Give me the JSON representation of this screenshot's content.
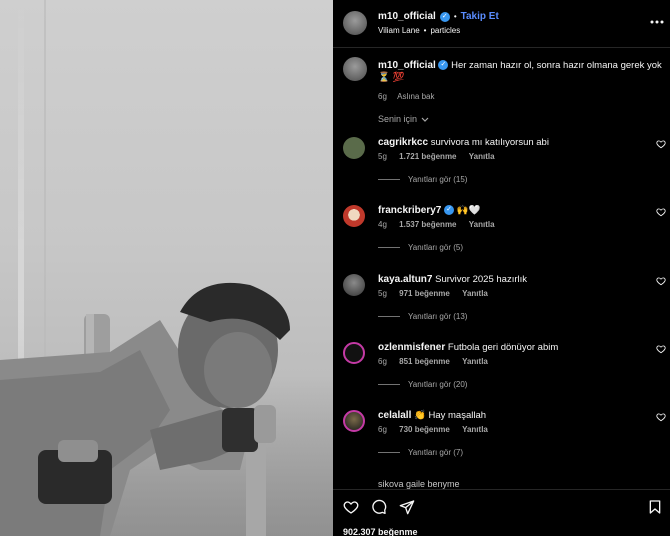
{
  "post": {
    "author": "m10_official",
    "follow_label": "Takip Et",
    "separator": "•",
    "audio": "Viliam Lane",
    "audio_sep": "•",
    "audio_track": "particles"
  },
  "caption": {
    "username": "m10_official",
    "text": "Her zaman hazır ol, sonra hazır olmana gerek yok",
    "emoji": "⏳ 💯",
    "age": "6g",
    "see_translation": "Aslına bak"
  },
  "sort": {
    "label": "Senin için"
  },
  "comments": [
    {
      "username": "cagrikrkcc",
      "verified": false,
      "text": "survivora mı katılıyorsun abi",
      "age": "5g",
      "likes": "1.721 beğenme",
      "reply": "Yanıtla",
      "replies": "Yanıtları gör (15)",
      "avatar_color": "#5a6b4a"
    },
    {
      "username": "franckribery7",
      "verified": true,
      "text": "🙌🤍",
      "age": "4g",
      "likes": "1.537 beğenme",
      "reply": "Yanıtla",
      "replies": "Yanıtları gör (5)",
      "avatar_color": "#c0392b"
    },
    {
      "username": "kaya.altun7",
      "verified": false,
      "text": "Survivor 2025 hazırlık",
      "age": "5g",
      "likes": "971 beğenme",
      "reply": "Yanıtla",
      "replies": "Yanıtları gör (13)",
      "avatar_color": "#555555"
    },
    {
      "username": "ozlenmisfener",
      "verified": false,
      "text": "Futbola geri dönüyor abim",
      "age": "6g",
      "likes": "851 beğenme",
      "reply": "Yanıtla",
      "replies": "Yanıtları gör (20)",
      "avatar_color": "#1a1a2e"
    },
    {
      "username": "celalall",
      "verified": false,
      "text": "👏 Hay maşallah",
      "age": "6g",
      "likes": "730 beğenme",
      "reply": "Yanıtla",
      "replies": "Yanıtları gör (7)",
      "avatar_color": "#2c2c2c"
    }
  ],
  "cut_comment": "sikova gaile benyme",
  "footer": {
    "likes": "902.307 beğenme"
  },
  "colors": {
    "accent": "#5a8dff",
    "verified": "#3897f0",
    "muted": "#a8a8a8"
  }
}
